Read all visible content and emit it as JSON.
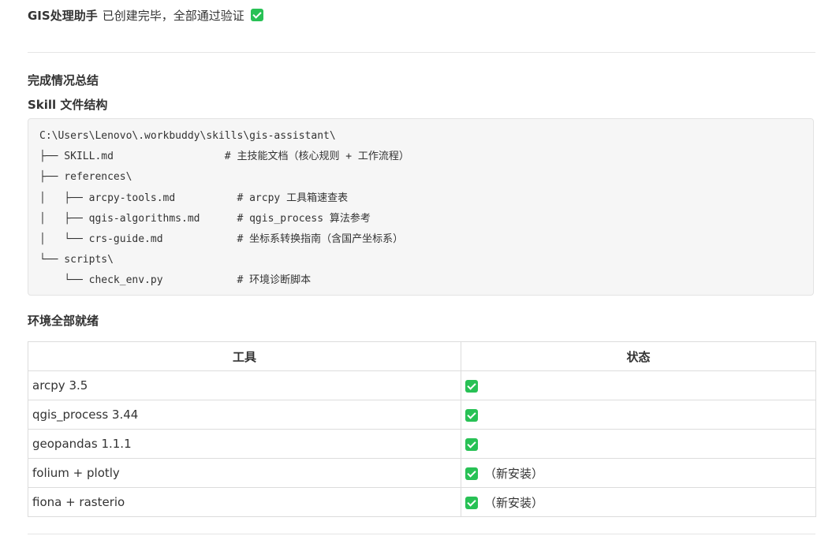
{
  "header": {
    "app_name": "GIS处理助手",
    "message": "已创建完毕，全部通过验证",
    "status_icon": "check-icon"
  },
  "summary_title": "完成情况总结",
  "skill_section": {
    "title": "Skill 文件结构",
    "code": "C:\\Users\\Lenovo\\.workbuddy\\skills\\gis-assistant\\\n├── SKILL.md                  # 主技能文档（核心规则 + 工作流程）\n├── references\\\n│   ├── arcpy-tools.md          # arcpy 工具箱速查表\n│   ├── qgis-algorithms.md      # qgis_process 算法参考\n│   └── crs-guide.md            # 坐标系转换指南（含国产坐标系）\n└── scripts\\\n    └── check_env.py            # 环境诊断脚本"
  },
  "env_section": {
    "title": "环境全部就绪",
    "columns": [
      "工具",
      "状态"
    ],
    "rows": [
      {
        "tool": "arcpy 3.5",
        "status_icon": "check-icon",
        "note": ""
      },
      {
        "tool": "qgis_process 3.44",
        "status_icon": "check-icon",
        "note": ""
      },
      {
        "tool": "geopandas 1.1.1",
        "status_icon": "check-icon",
        "note": ""
      },
      {
        "tool": "folium + plotly",
        "status_icon": "check-icon",
        "note": "（新安装）"
      },
      {
        "tool": "fiona + rasterio",
        "status_icon": "check-icon",
        "note": "（新安装）"
      }
    ],
    "check_color": "#28c155"
  }
}
